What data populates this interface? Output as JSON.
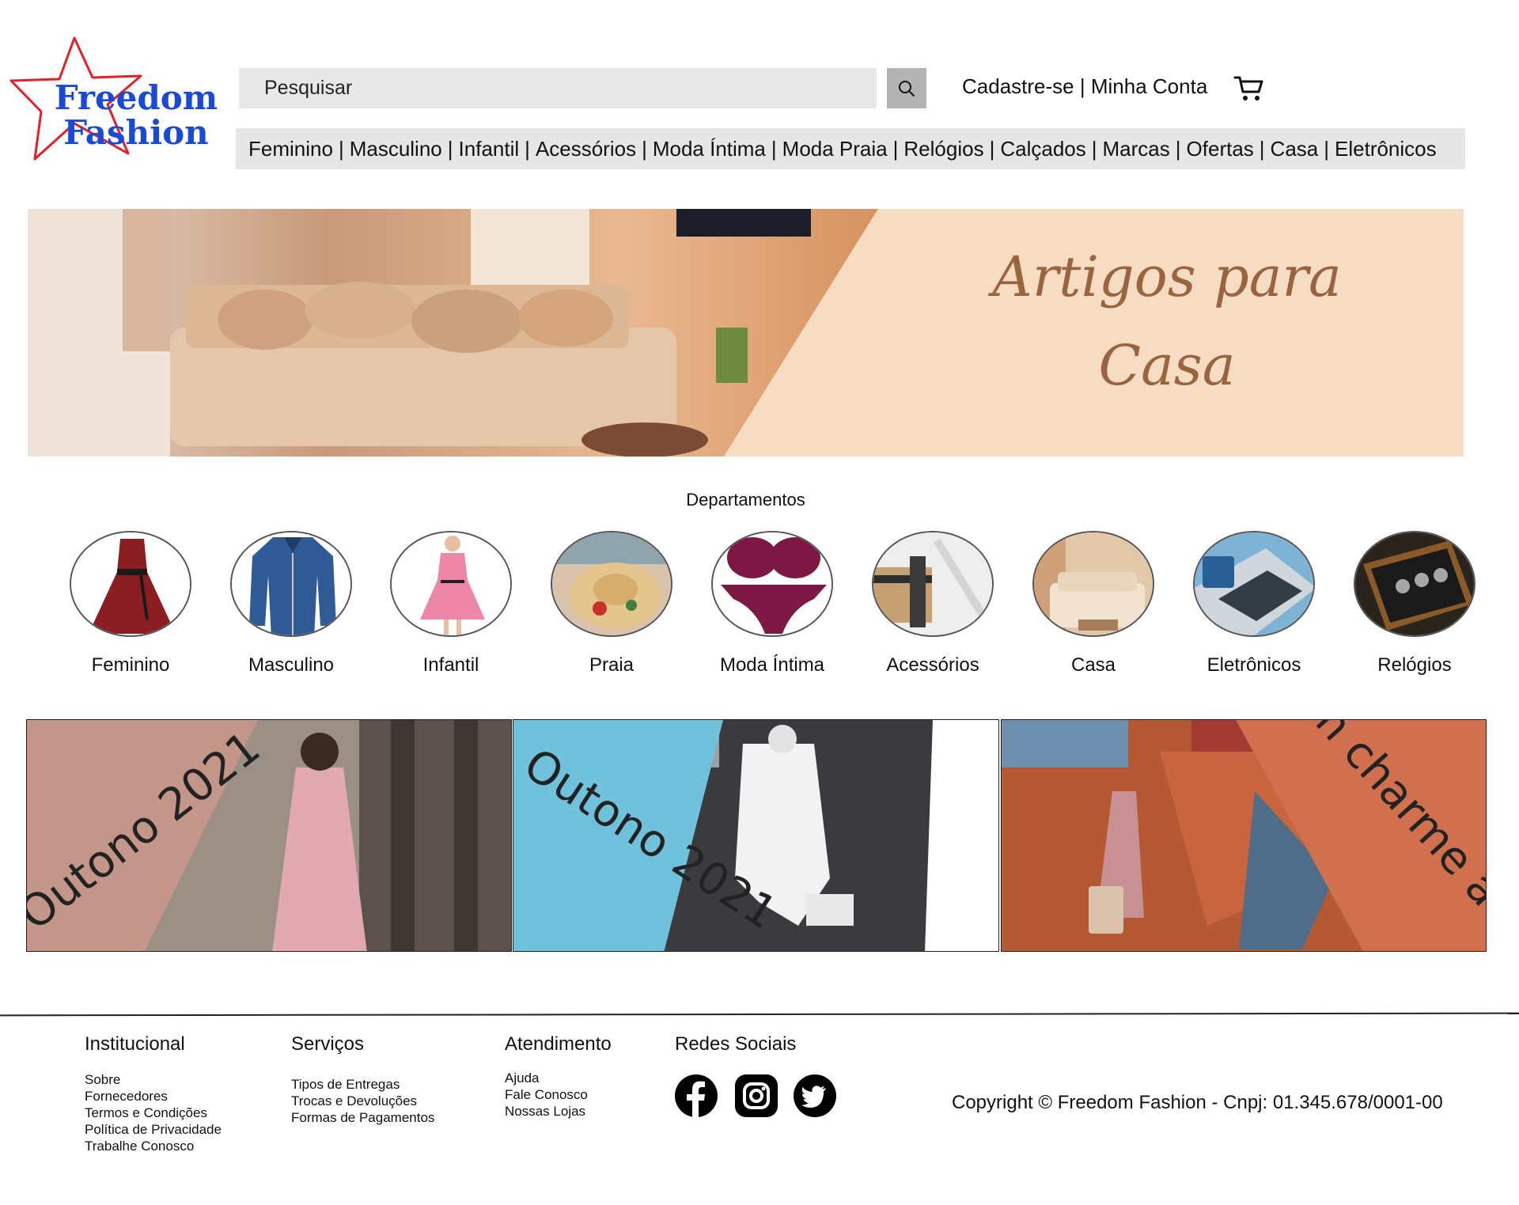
{
  "brand": {
    "line1": "Freedom",
    "line2": "Fashion",
    "color": "#1a49d8",
    "star_color": "#e0202a"
  },
  "search": {
    "placeholder": "Pesquisar",
    "icon": "search-icon"
  },
  "account": {
    "signup": "Cadastre-se",
    "separator": "|",
    "my_account": "Minha Conta",
    "cart_icon": "cart-icon"
  },
  "nav": {
    "separator": "|",
    "items": [
      "Feminino",
      "Masculino",
      "Infantil",
      "Acessórios",
      "Moda Íntima",
      "Moda Praia",
      "Relógios",
      "Calçados",
      "Marcas",
      "Ofertas",
      "Casa",
      "Eletrônicos"
    ]
  },
  "hero": {
    "line1": "Artigos para",
    "line2": "Casa",
    "text_color": "#9a6440",
    "panel_color": "#f6dcc2"
  },
  "departments": {
    "title": "Departamentos",
    "items": [
      {
        "label": "Feminino"
      },
      {
        "label": "Masculino"
      },
      {
        "label": "Infantil"
      },
      {
        "label": "Praia"
      },
      {
        "label": "Moda Íntima"
      },
      {
        "label": "Acessórios"
      },
      {
        "label": "Casa"
      },
      {
        "label": "Eletrônicos"
      },
      {
        "label": "Relógios"
      }
    ]
  },
  "promos": [
    {
      "text": "Outono 2021",
      "panel_color": "#c4968a"
    },
    {
      "text": "Outono 2021",
      "panel_color": "#6fc1dc"
    },
    {
      "text": "Um charme a mais",
      "panel_color": "#d0704f"
    }
  ],
  "footer": {
    "institucional": {
      "title": "Institucional",
      "links": [
        "Sobre",
        "Fornecedores",
        "Termos e Condições",
        "Política de Privacidade",
        "Trabalhe Conosco"
      ]
    },
    "servicos": {
      "title": "Serviços",
      "links": [
        "Tipos de Entregas",
        "Trocas e Devoluções",
        "Formas de Pagamentos"
      ]
    },
    "atendimento": {
      "title": "Atendimento",
      "links": [
        "Ajuda",
        "Fale Conosco",
        "Nossas Lojas"
      ]
    },
    "social": {
      "title": "Redes Sociais",
      "icons": [
        "facebook-icon",
        "instagram-icon",
        "twitter-icon"
      ]
    },
    "copyright": "Copyright  © Freedom Fashion -  Cnpj: 01.345.678/0001-00"
  }
}
